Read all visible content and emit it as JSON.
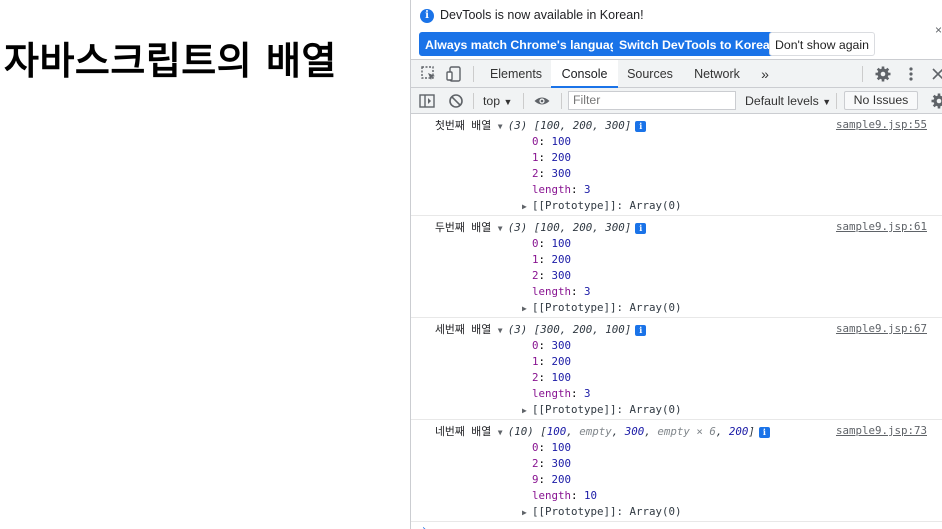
{
  "page": {
    "heading": "자바스크립트의 배열"
  },
  "infobar": {
    "icon": "info-icon",
    "message": "DevTools is now available in Korean!",
    "btn_match": "Always match Chrome's language",
    "btn_switch": "Switch DevTools to Korean",
    "btn_dont_show": "Don't show again",
    "close": "×"
  },
  "tabbar": {
    "tabs": [
      {
        "label": "Elements"
      },
      {
        "label": "Console"
      },
      {
        "label": "Sources"
      },
      {
        "label": "Network"
      }
    ],
    "more": "»",
    "active_tab": "Console"
  },
  "filterbar": {
    "context": "top",
    "filter_placeholder": "Filter",
    "levels": "Default levels",
    "issues": "No Issues"
  },
  "console": {
    "messages": [
      {
        "label": "첫번째 배열",
        "count": "(3)",
        "preview": "[100, 200, 300]",
        "source": "sample9.jsp:55",
        "entries": [
          {
            "key": "0",
            "value": "100"
          },
          {
            "key": "1",
            "value": "200"
          },
          {
            "key": "2",
            "value": "300"
          }
        ],
        "length_key": "length",
        "length_value": "3",
        "prototype": "[[Prototype]]: Array(0)"
      },
      {
        "label": "두번째 배열",
        "count": "(3)",
        "preview": "[100, 200, 300]",
        "source": "sample9.jsp:61",
        "entries": [
          {
            "key": "0",
            "value": "100"
          },
          {
            "key": "1",
            "value": "200"
          },
          {
            "key": "2",
            "value": "300"
          }
        ],
        "length_key": "length",
        "length_value": "3",
        "prototype": "[[Prototype]]: Array(0)"
      },
      {
        "label": "세번째 배열",
        "count": "(3)",
        "preview": "[300, 200, 100]",
        "source": "sample9.jsp:67",
        "entries": [
          {
            "key": "0",
            "value": "300"
          },
          {
            "key": "1",
            "value": "200"
          },
          {
            "key": "2",
            "value": "100"
          }
        ],
        "length_key": "length",
        "length_value": "3",
        "prototype": "[[Prototype]]: Array(0)"
      },
      {
        "label": "네번째 배열",
        "count": "(10)",
        "preview_parts": [
          {
            "t": "[",
            "c": "preview"
          },
          {
            "t": "100",
            "c": "num"
          },
          {
            "t": ", ",
            "c": "preview"
          },
          {
            "t": "empty",
            "c": "empty"
          },
          {
            "t": ", ",
            "c": "preview"
          },
          {
            "t": "300",
            "c": "num"
          },
          {
            "t": ", ",
            "c": "preview"
          },
          {
            "t": "empty × 6",
            "c": "empty"
          },
          {
            "t": ", ",
            "c": "preview"
          },
          {
            "t": "200",
            "c": "num"
          },
          {
            "t": "]",
            "c": "preview"
          }
        ],
        "source": "sample9.jsp:73",
        "entries": [
          {
            "key": "0",
            "value": "100"
          },
          {
            "key": "2",
            "value": "300"
          },
          {
            "key": "9",
            "value": "200"
          }
        ],
        "length_key": "length",
        "length_value": "10",
        "prototype": "[[Prototype]]: Array(0)"
      }
    ]
  }
}
